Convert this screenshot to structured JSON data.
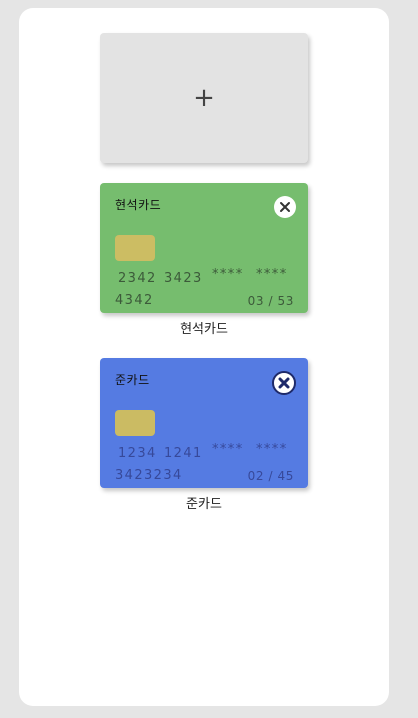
{
  "add_card": {
    "symbol": "+"
  },
  "cards": [
    {
      "name": "현석카드",
      "numbers": [
        "2342",
        "3423",
        "****",
        "****"
      ],
      "owner_line": "4342",
      "expiry": "03 / 53",
      "caption": "현석카드",
      "color": "#76bd6e"
    },
    {
      "name": "준카드",
      "numbers": [
        "1234",
        "1241",
        "****",
        "****"
      ],
      "owner_line": "3423234",
      "expiry": "02 / 45",
      "caption": "준카드",
      "color": "#557be2"
    }
  ]
}
